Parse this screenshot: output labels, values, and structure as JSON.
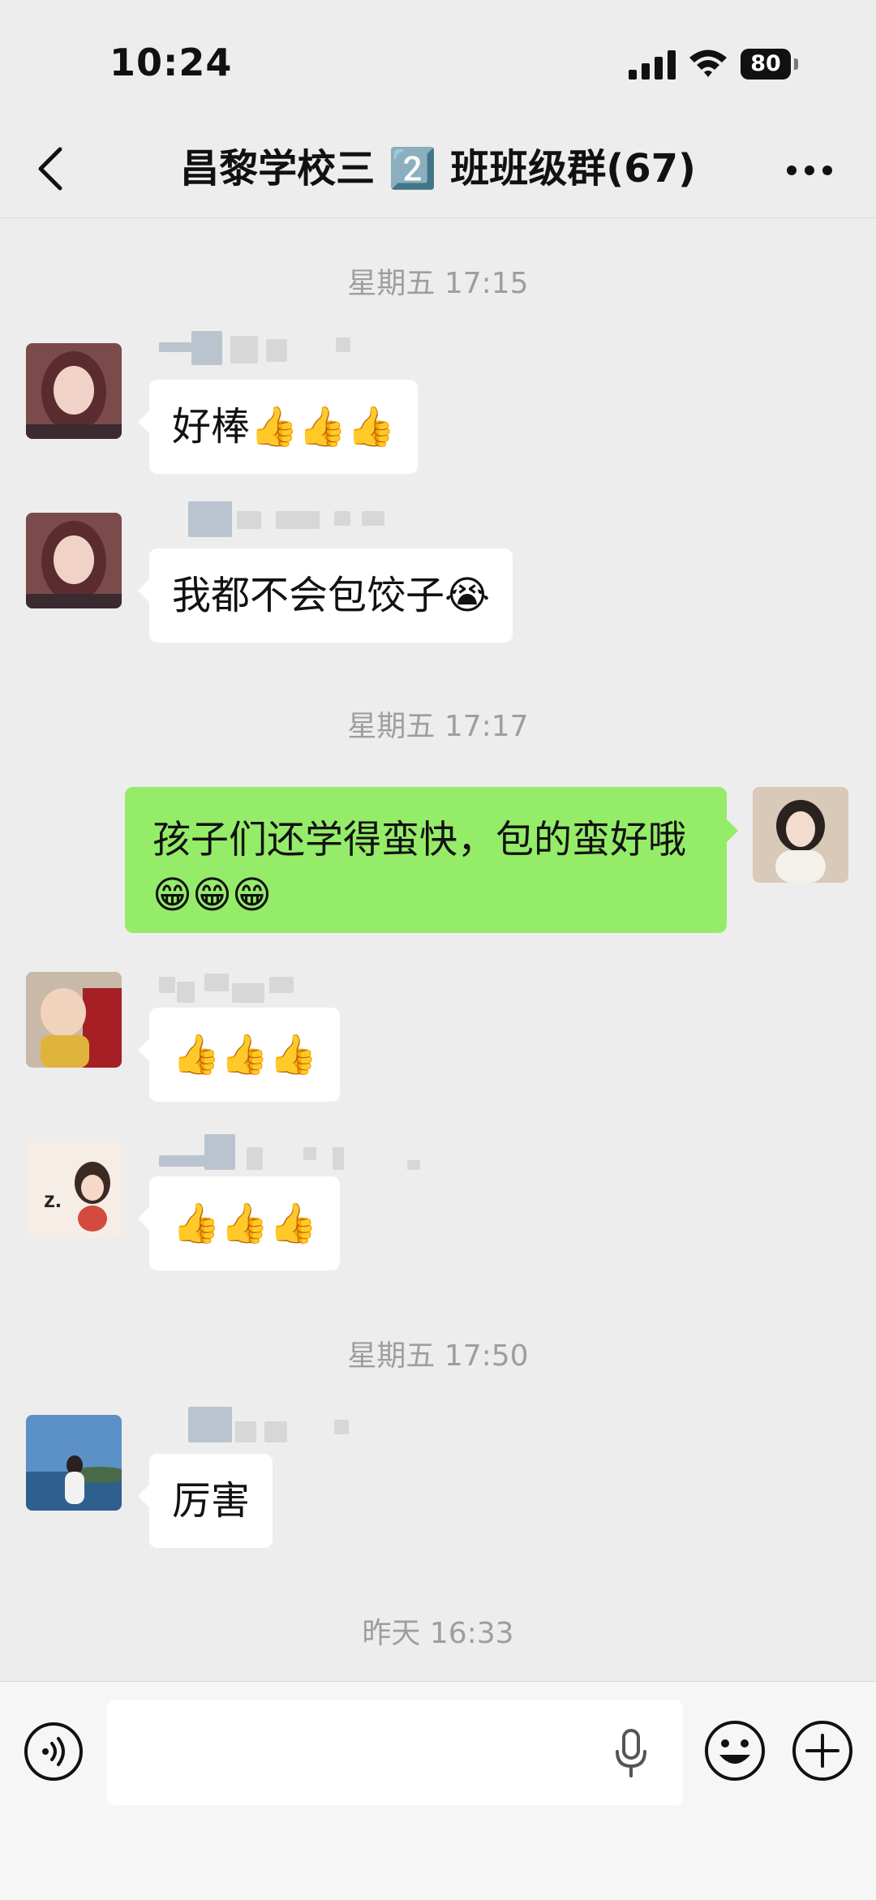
{
  "status_bar": {
    "time": "10:24",
    "battery": "80"
  },
  "header": {
    "title": "昌黎学校三 2️⃣ 班班级群(67)"
  },
  "timestamps": {
    "t1": "星期五 17:15",
    "t2": "星期五 17:17",
    "t3": "星期五 17:50",
    "t4": "昨天 16:33"
  },
  "messages": [
    {
      "side": "incoming",
      "text": "好棒👍👍👍"
    },
    {
      "side": "incoming",
      "text": "我都不会包饺子😭"
    },
    {
      "side": "outgoing",
      "text": "孩子们还学得蛮快，包的蛮好哦😁😁😁"
    },
    {
      "side": "incoming",
      "text": "👍👍👍"
    },
    {
      "side": "incoming",
      "text": "👍👍👍"
    },
    {
      "side": "incoming",
      "text": "厉害"
    }
  ],
  "icons": {
    "back": "chevron-left-icon",
    "more": "more-dots-icon",
    "voice": "voice-icon",
    "mic": "mic-icon",
    "emoji": "emoji-icon",
    "plus": "plus-icon"
  },
  "colors": {
    "chat_bg": "#ededed",
    "outgoing_bubble": "#95ec69",
    "incoming_bubble": "#ffffff",
    "timestamp_text": "#9e9e9e"
  }
}
